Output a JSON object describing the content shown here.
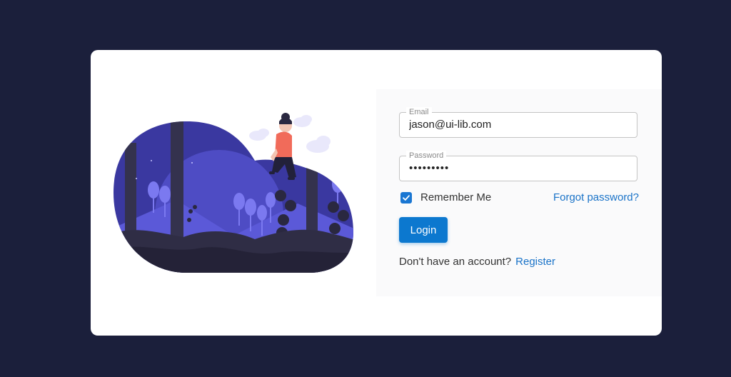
{
  "form": {
    "email": {
      "label": "Email",
      "value": "jason@ui-lib.com"
    },
    "password": {
      "label": "Password",
      "value": "•••••••••"
    },
    "remember_label": "Remember Me",
    "remember_checked": true,
    "forgot_label": "Forgot password?",
    "login_label": "Login",
    "no_account_text": "Don't have an account?",
    "register_label": "Register"
  },
  "colors": {
    "background": "#1b1f3b",
    "card": "#ffffff",
    "accent": "#0c78cf",
    "link": "#1a73c8"
  }
}
